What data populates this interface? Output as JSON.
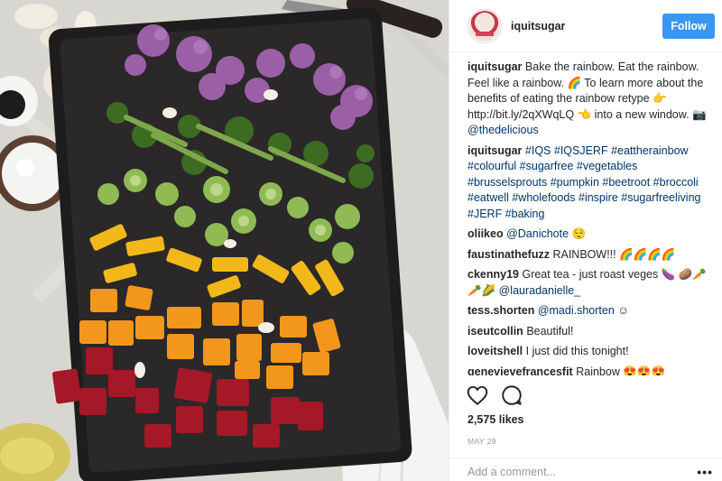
{
  "post": {
    "username": "iquitsugar",
    "follow_label": "Follow",
    "photo_alt": "Tray of roasted vegetables arranged in rainbow order"
  },
  "comments": [
    {
      "user": "iquitsugar",
      "text": "Bake the rainbow. Eat the rainbow. Feel like a rainbow. 🌈 To learn more about the benefits of eating the rainbow retype 👉 http://bit.ly/2qXWqLQ 👈 into a new window. 📷 ",
      "mention": "@thedelicious"
    },
    {
      "user": "iquitsugar",
      "text": "",
      "mention": "#IQS #IQSJERF #eattherainbow #colourful #sugarfree #vegetables #brusselsprouts #pumpkin #beetroot #broccoli #eatwell #wholefoods #inspire #sugarfreeliving #JERF #baking"
    },
    {
      "user": "oliikeo",
      "text": "",
      "mention": "@Danichote",
      "suffix": " 😌"
    },
    {
      "user": "faustinathefuzz",
      "text": "RAINBOW!!! 🌈🌈🌈🌈",
      "mention": ""
    },
    {
      "user": "ckenny19",
      "text": "Great tea - just roast veges 🍆 🥔🥕🥕🌽 ",
      "mention": "@lauradanielle_"
    },
    {
      "user": "tess.shorten",
      "text": "",
      "mention": "@madi.shorten",
      "suffix": " ☺"
    },
    {
      "user": "iseutcollin",
      "text": "Beautiful!",
      "mention": ""
    },
    {
      "user": "loveitshell",
      "text": "I just did this tonight!",
      "mention": ""
    },
    {
      "user": "genevievefrancesfit",
      "text": "Rainbow 😍😍😍",
      "mention": ""
    }
  ],
  "actions": {
    "like_icon": "heart-icon",
    "comment_icon": "comment-icon"
  },
  "likes_text": "2,575 likes",
  "date_text": "MAY 29",
  "add_comment_placeholder": "Add a comment...",
  "more_label": "•••",
  "colors": {
    "follow_button": "#3897f0",
    "link": "#003569",
    "muted": "#999999"
  }
}
